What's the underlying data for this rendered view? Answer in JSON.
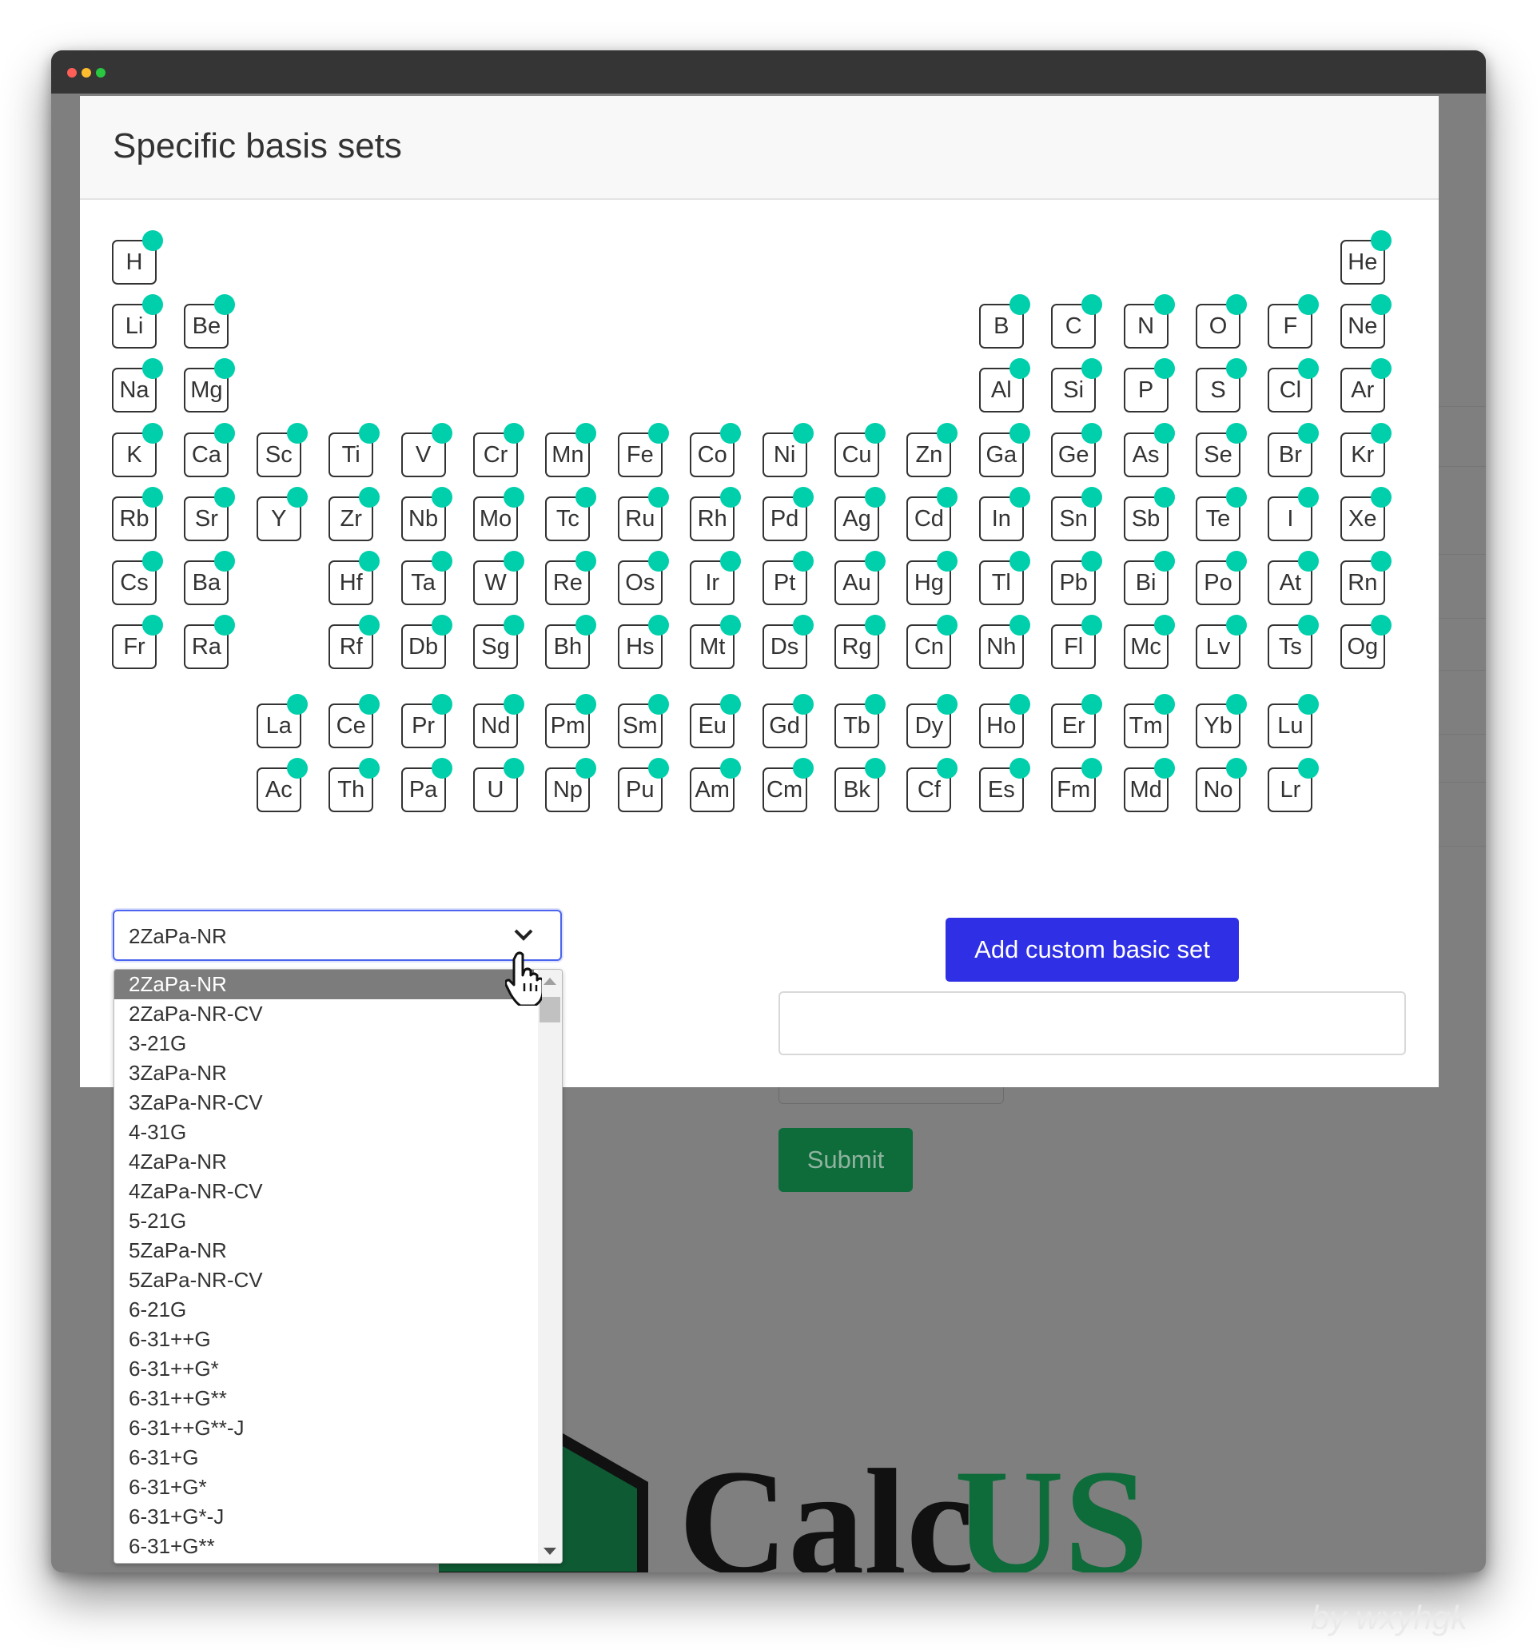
{
  "modal": {
    "title": "Specific basis sets",
    "add_button_label": "Add custom basic set",
    "custom_input_value": ""
  },
  "colors": {
    "dot": "#00cfac",
    "add_button": "#2f2fe5",
    "submit_button": "#0e6b3a",
    "select_focus_border": "#4a64ef"
  },
  "elements": {
    "main": [
      [
        "H",
        "",
        "",
        "",
        "",
        "",
        "",
        "",
        "",
        "",
        "",
        "",
        "",
        "",
        "",
        "",
        "",
        "He"
      ],
      [
        "Li",
        "Be",
        "",
        "",
        "",
        "",
        "",
        "",
        "",
        "",
        "",
        "",
        "B",
        "C",
        "N",
        "O",
        "F",
        "Ne"
      ],
      [
        "Na",
        "Mg",
        "",
        "",
        "",
        "",
        "",
        "",
        "",
        "",
        "",
        "",
        "Al",
        "Si",
        "P",
        "S",
        "Cl",
        "Ar"
      ],
      [
        "K",
        "Ca",
        "Sc",
        "Ti",
        "V",
        "Cr",
        "Mn",
        "Fe",
        "Co",
        "Ni",
        "Cu",
        "Zn",
        "Ga",
        "Ge",
        "As",
        "Se",
        "Br",
        "Kr"
      ],
      [
        "Rb",
        "Sr",
        "Y",
        "Zr",
        "Nb",
        "Mo",
        "Tc",
        "Ru",
        "Rh",
        "Pd",
        "Ag",
        "Cd",
        "In",
        "Sn",
        "Sb",
        "Te",
        "I",
        "Xe"
      ],
      [
        "Cs",
        "Ba",
        "",
        "Hf",
        "Ta",
        "W",
        "Re",
        "Os",
        "Ir",
        "Pt",
        "Au",
        "Hg",
        "Tl",
        "Pb",
        "Bi",
        "Po",
        "At",
        "Rn"
      ],
      [
        "Fr",
        "Ra",
        "",
        "Rf",
        "Db",
        "Sg",
        "Bh",
        "Hs",
        "Mt",
        "Ds",
        "Rg",
        "Cn",
        "Nh",
        "Fl",
        "Mc",
        "Lv",
        "Ts",
        "Og"
      ]
    ],
    "lanthanides": [
      "La",
      "Ce",
      "Pr",
      "Nd",
      "Pm",
      "Sm",
      "Eu",
      "Gd",
      "Tb",
      "Dy",
      "Ho",
      "Er",
      "Tm",
      "Yb",
      "Lu"
    ],
    "actinides": [
      "Ac",
      "Th",
      "Pa",
      "U",
      "Np",
      "Pu",
      "Am",
      "Cm",
      "Bk",
      "Cf",
      "Es",
      "Fm",
      "Md",
      "No",
      "Lr"
    ]
  },
  "basis_select": {
    "selected": "2ZaPa-NR",
    "options": [
      "2ZaPa-NR",
      "2ZaPa-NR-CV",
      "3-21G",
      "3ZaPa-NR",
      "3ZaPa-NR-CV",
      "4-31G",
      "4ZaPa-NR",
      "4ZaPa-NR-CV",
      "5-21G",
      "5ZaPa-NR",
      "5ZaPa-NR-CV",
      "6-21G",
      "6-31++G",
      "6-31++G*",
      "6-31++G**",
      "6-31++G**-J",
      "6-31+G",
      "6-31+G*",
      "6-31+G*-J",
      "6-31+G**"
    ]
  },
  "background": {
    "submit_label": "Submit",
    "logo_text_a": "Calc",
    "logo_text_b": "US"
  },
  "watermark": "by wxyhgk"
}
